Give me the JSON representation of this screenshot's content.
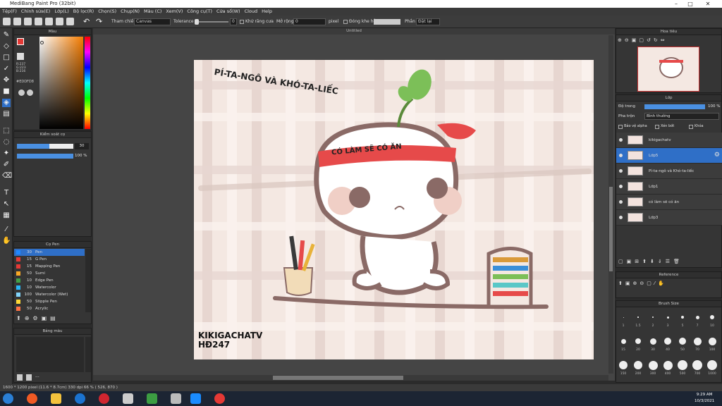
{
  "window": {
    "title": "MediBang Paint Pro (32bit)"
  },
  "menu": [
    "Tệp(F)",
    "Chỉnh sửa(E)",
    "Lớp(L)",
    "Bộ lọc(R)",
    "Chọn(S)",
    "Chụp(N)",
    "Màu (C)",
    "Xem(V)",
    "Công cụ(T)",
    "Cửa sổ(W)",
    "Cloud",
    "Help"
  ],
  "toolbar": {
    "ref_label": "Tham chiếu",
    "ref_value": "Canvas",
    "tolerance_label": "Tolerance",
    "tolerance_value": "0",
    "antialias_label": "Khử răng cưa",
    "expand_label": "Mở rộng",
    "expand_value": "0",
    "expand_unit": "pixel",
    "closegap_label": "Đóng khe hở",
    "phan_label": "Phần",
    "phan_value": "Đặt lại"
  },
  "color_panel": {
    "title": "Màu",
    "r": "R:237",
    "g": "G:223",
    "b": "B:216",
    "hex": "#EDDFD8"
  },
  "brush_control": {
    "title": "Kiểm soát cọ",
    "size_value": "30",
    "opacity_value": "100 %"
  },
  "pens_panel": {
    "title": "Cọ Pen",
    "items": [
      {
        "size": "30",
        "name": "Pen",
        "color": "#1e88ff",
        "selected": true
      },
      {
        "size": "15",
        "name": "G Pen",
        "color": "#e53935"
      },
      {
        "size": "15",
        "name": "Mapping Pen",
        "color": "#e53935"
      },
      {
        "size": "50",
        "name": "Sumi",
        "color": "#f9a825"
      },
      {
        "size": "10",
        "name": "Edge Pen",
        "color": "#43a047"
      },
      {
        "size": "10",
        "name": "Watercolor",
        "color": "#29b6f6"
      },
      {
        "size": "100",
        "name": "Watercolor (Wet)",
        "color": "#81d4fa"
      },
      {
        "size": "50",
        "name": "Stipple Pen",
        "color": "#fdd835"
      },
      {
        "size": "50",
        "name": "Acrylic",
        "color": "#ff7043"
      }
    ]
  },
  "palette_panel": {
    "title": "Bảng màu",
    "footer": "..."
  },
  "canvas": {
    "tab_title": "Untitled",
    "text_title": "PÍ-TA-NGÔ VÀ KHÓ-TA-LIẾC",
    "headband": "CÓ LÀM SẼ CÓ ĂN",
    "watermark_line1": "KIKIGACHATV",
    "watermark_line2": "HĐ247"
  },
  "navigator": {
    "title": "Hoa tiêu"
  },
  "layers_panel": {
    "title": "Lớp",
    "opacity_label": "Độ trong",
    "opacity_value": "100 %",
    "blend_label": "Pha trộn",
    "blend_value": "Bình thường",
    "protect_alpha": "Bảo vệ alpha",
    "clipping": "Xén bớt",
    "lock": "Khóa",
    "layers": [
      {
        "name": "kikigachatv",
        "selected": false
      },
      {
        "name": "Lớp5",
        "selected": true
      },
      {
        "name": "Pí-ta-ngô và Khó-ta-liếc",
        "selected": false
      },
      {
        "name": "Lớp1",
        "selected": false
      },
      {
        "name": "có làm sẽ có ăn",
        "selected": false
      },
      {
        "name": "Lớp3",
        "selected": false
      }
    ]
  },
  "reference_panel": {
    "title": "Reference"
  },
  "brush_size_panel": {
    "title": "Brush Size",
    "labels": [
      "1",
      "1.5",
      "2",
      "3",
      "5",
      "7",
      "10",
      "15",
      "20",
      "30",
      "40",
      "50",
      "70",
      "100",
      "150",
      "200",
      "300",
      "400",
      "500",
      "700",
      "1000"
    ]
  },
  "status": {
    "text": "1600 * 1200 pixel  (11.6 * 8.7cm)  330 dpi  66 %  ( 526, 870 )"
  },
  "taskbar": {
    "time": "9:29 AM",
    "date": "10/3/2021"
  },
  "colors": {
    "accent": "#1e6fd9",
    "headband": "#e64a4a",
    "outline": "#8a6a66"
  }
}
